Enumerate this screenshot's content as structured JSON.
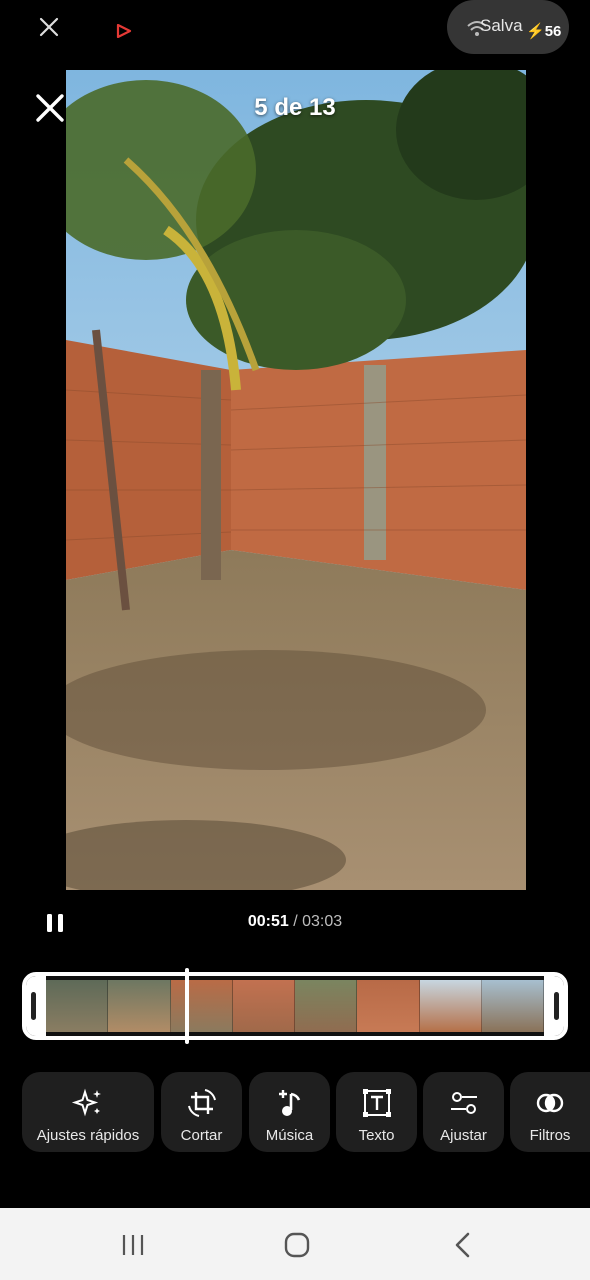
{
  "status": {
    "save_label": "Salva",
    "battery": "56"
  },
  "viewer": {
    "counter": "5 de 13"
  },
  "player": {
    "current_time": "00:51",
    "separator": " / ",
    "total_time": "03:03"
  },
  "tools": [
    {
      "label": "Ajustes rápidos",
      "icon": "sparkle-icon"
    },
    {
      "label": "Cortar",
      "icon": "crop-rotate-icon"
    },
    {
      "label": "Música",
      "icon": "music-add-icon"
    },
    {
      "label": "Texto",
      "icon": "text-box-icon"
    },
    {
      "label": "Ajustar",
      "icon": "sliders-icon"
    },
    {
      "label": "Filtros",
      "icon": "filters-icon"
    }
  ],
  "colors": {
    "background": "#000000",
    "tool_bg": "#1f1f1f",
    "navbar": "#f3f3f3",
    "accent_red": "#e53935"
  }
}
